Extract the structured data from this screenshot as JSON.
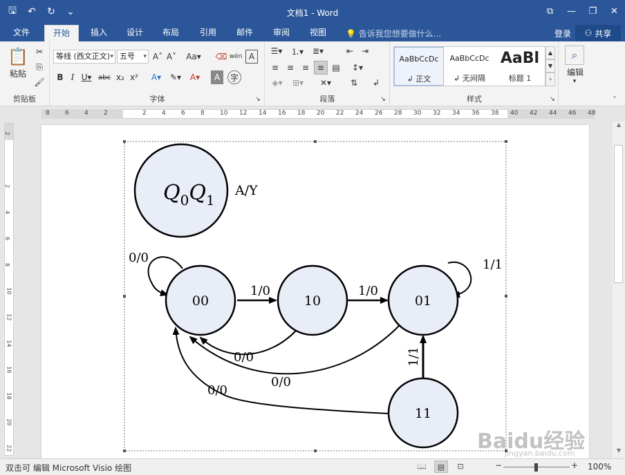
{
  "titlebar": {
    "title": "文档1 - Word",
    "qat": [
      {
        "icon": "save-icon",
        "glyph": "🖫"
      },
      {
        "icon": "undo-icon",
        "glyph": "↶"
      },
      {
        "icon": "redo-icon",
        "glyph": "↻"
      },
      {
        "icon": "customize-qat-icon",
        "glyph": "⌄"
      }
    ],
    "controls": [
      {
        "icon": "ribbon-display-icon",
        "glyph": "⧉"
      },
      {
        "icon": "minimize-icon",
        "glyph": "—"
      },
      {
        "icon": "restore-icon",
        "glyph": "❐"
      },
      {
        "icon": "close-icon",
        "glyph": "✕"
      }
    ],
    "accent": "#2b579a"
  },
  "tabs": [
    "文件",
    "开始",
    "插入",
    "设计",
    "布局",
    "引用",
    "邮件",
    "审阅",
    "视图"
  ],
  "active_tab": "开始",
  "tell_me": "告诉我您想要做什么...",
  "login": "登录",
  "share": "共享",
  "ribbon": {
    "clipboard": {
      "label": "剪贴板",
      "paste": "粘贴"
    },
    "font": {
      "label": "字体",
      "font_name": "等线 (西文正文)",
      "font_size": "五号"
    },
    "paragraph": {
      "label": "段落"
    },
    "styles": {
      "label": "样式",
      "items": [
        {
          "preview": "AaBbCcDc",
          "name": "↲ 正文"
        },
        {
          "preview": "AaBbCcDc",
          "name": "↲ 无间隔"
        },
        {
          "preview": "AaBl",
          "name": "标题 1"
        }
      ]
    },
    "editing": {
      "label": "编辑"
    }
  },
  "ruler": {
    "h_ticks": [
      "8",
      "6",
      "4",
      "2",
      "",
      "2",
      "4",
      "6",
      "8",
      "10",
      "12",
      "14",
      "16",
      "18",
      "20",
      "22",
      "24",
      "26",
      "28",
      "30",
      "32",
      "34",
      "36",
      "38",
      "40",
      "42",
      "44",
      "46",
      "48"
    ],
    "v_ticks": [
      "2",
      "",
      "2",
      "4",
      "6",
      "8",
      "10",
      "12",
      "14",
      "16",
      "18",
      "20",
      "22"
    ]
  },
  "diagram": {
    "legend_state": "Q0Q1",
    "legend_io": "A/Y",
    "states": [
      "00",
      "10",
      "01",
      "11"
    ],
    "transitions": [
      {
        "from": "00",
        "to": "00",
        "label": "0/0"
      },
      {
        "from": "00",
        "to": "10",
        "label": "1/0"
      },
      {
        "from": "10",
        "to": "01",
        "label": "1/0"
      },
      {
        "from": "01",
        "to": "01",
        "label": "1/1"
      },
      {
        "from": "10",
        "to": "00",
        "label": "0/0"
      },
      {
        "from": "01",
        "to": "00",
        "label": "0/0"
      },
      {
        "from": "11",
        "to": "01",
        "label": "1/1"
      },
      {
        "from": "11",
        "to": "00",
        "label": "0/0"
      }
    ],
    "state_fill": "#e8edf7"
  },
  "statusbar": {
    "text": "双击可 编辑 Microsoft Visio 绘图",
    "zoom": "100%"
  },
  "watermark": {
    "logo": "Baidu经验",
    "url": "jingyan.baidu.com"
  }
}
